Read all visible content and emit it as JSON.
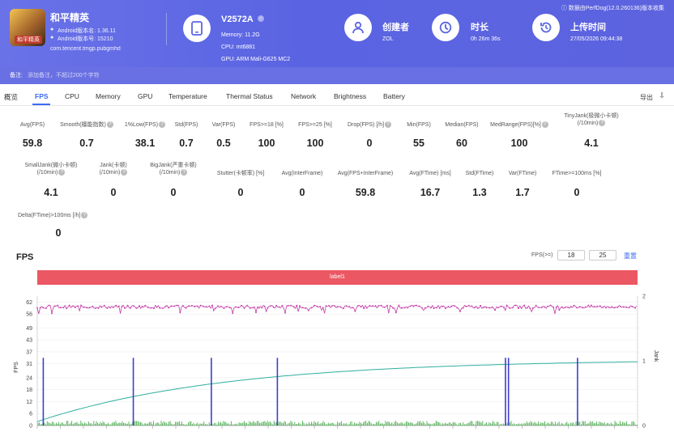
{
  "app": {
    "name": "和平精英",
    "icon_label": "和平精英",
    "version_label": "Android版本名: 1.36.11",
    "code_label": "Android版本号: 15210",
    "package": "com.tencent.tmgp.pubgmhd"
  },
  "device": {
    "name": "V2572A",
    "memory": "Memory: 11.2G",
    "cpu": "CPU: mt6881",
    "gpu": "GPU: ARM Mali-G625 MC2"
  },
  "creator": {
    "title": "创建者",
    "value": "ZOL"
  },
  "duration": {
    "title": "时长",
    "value": "0h 26m 36s"
  },
  "upload": {
    "title": "上传时间",
    "value": "27/05/2026 09:44:38"
  },
  "version_note": "数据由PerfDog(12.0.260136)版本收集",
  "note": {
    "label": "备注:",
    "placeholder": "添加备注，不超过200个字符"
  },
  "tabs": [
    "概览",
    "FPS",
    "CPU",
    "Memory",
    "GPU",
    "Temperature",
    "Thermal Status",
    "Network",
    "Brightness",
    "Battery"
  ],
  "export_label": "导出",
  "stats_row1": [
    {
      "label": "Avg(FPS)",
      "value": "59.8"
    },
    {
      "label": "Smooth(檀能指数)",
      "value": "0.7"
    },
    {
      "label": "1%Low(FPS)",
      "value": "38.1"
    },
    {
      "label": "Std(FPS)",
      "value": "0.7"
    },
    {
      "label": "Var(FPS)",
      "value": "0.5"
    },
    {
      "label": "FPS>=18 [%]",
      "value": "100"
    },
    {
      "label": "FPS>=25 [%]",
      "value": "100"
    },
    {
      "label": "Drop(FPS) [/h]",
      "value": "0"
    },
    {
      "label": "Min(FPS)",
      "value": "55"
    },
    {
      "label": "Median(FPS)",
      "value": "60"
    },
    {
      "label": "MedRange(FPS)[%]",
      "value": "100"
    },
    {
      "label": "TinyJank(极微小卡顿)",
      "label2": "(/10min)",
      "value": "4.1"
    }
  ],
  "stats_row2": [
    {
      "label": "SmallJank(微小卡顿)",
      "label2": "(/10min)",
      "value": "4.1"
    },
    {
      "label": "Jank(卡顿)",
      "label2": "(/10min)",
      "value": "0"
    },
    {
      "label": "BigJank(严重卡顿)",
      "label2": "(/10min)",
      "value": "0"
    },
    {
      "label": "Stutter(卡顿率) [%]",
      "value": "0"
    },
    {
      "label": "Avg(InterFrame)",
      "value": "0"
    },
    {
      "label": "Avg(FPS+InterFrame)",
      "value": "59.8"
    },
    {
      "label": "Avg(FTime) [ms]",
      "value": "16.7"
    },
    {
      "label": "Std(FTime)",
      "value": "1.3"
    },
    {
      "label": "Var(FTime)",
      "value": "1.7"
    },
    {
      "label": "FTime>=100ms [%]",
      "value": "0"
    }
  ],
  "stats_row3": [
    {
      "label": "Delta(FTime)>100ms [/h]",
      "value": "0"
    }
  ],
  "fps_section": {
    "title": "FPS",
    "threshold_label": "FPS(>=)",
    "threshold1": "18",
    "threshold2": "25",
    "reset_label": "重置",
    "label_bar": "label1"
  },
  "chart_data": {
    "type": "line",
    "ylabel": "FPS",
    "y2label": "Jank",
    "y_ticks": [
      0,
      6,
      12,
      18,
      24,
      31,
      37,
      43,
      49,
      56,
      62
    ],
    "y2_ticks": [
      0,
      1,
      2
    ],
    "ylim": [
      0,
      65
    ],
    "y2lim": [
      0,
      2
    ],
    "series": [
      {
        "name": "FPS",
        "color": "#c43aa8",
        "values": "approximately constant near 59-60 FPS across the whole session, with sporadic dips to about 55-56"
      },
      {
        "name": "Jank",
        "color": "#3d3fc9",
        "spikes_at_fraction": [
          0.01,
          0.16,
          0.29,
          0.4,
          0.78,
          0.785,
          0.9
        ],
        "spike_fps": 34
      },
      {
        "name": "cumulative",
        "color": "#2fae9e",
        "start": 2,
        "end": 32
      }
    ],
    "bottom_bars_color": "#4caf50"
  }
}
